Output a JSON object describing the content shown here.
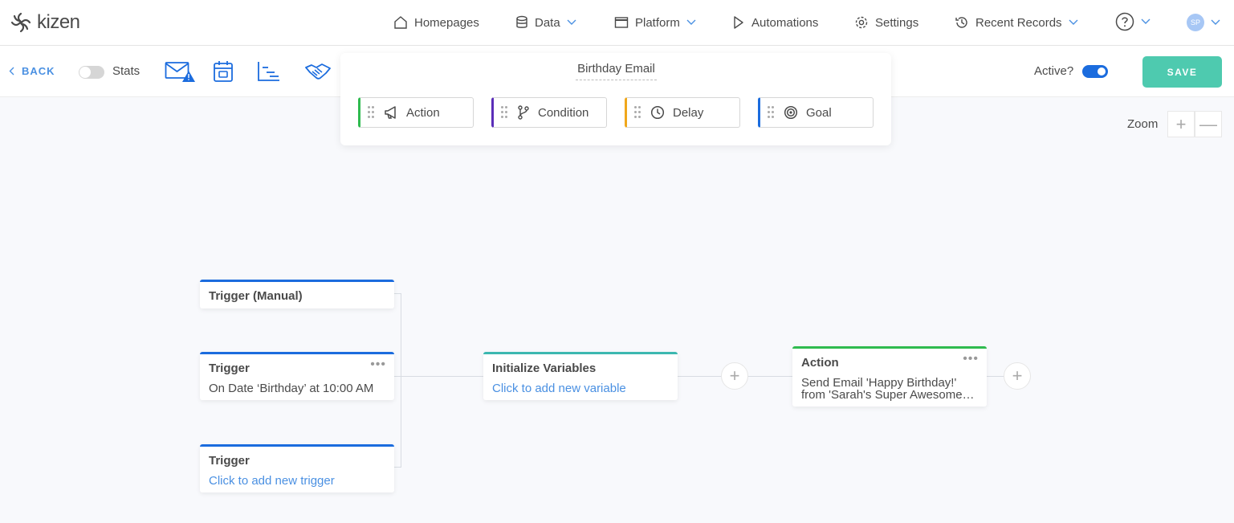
{
  "app": {
    "logo_text": "kizen"
  },
  "topnav": {
    "items": [
      {
        "label": "Homepages",
        "icon": "home-icon",
        "has_dropdown": false
      },
      {
        "label": "Data",
        "icon": "database-icon",
        "has_dropdown": true
      },
      {
        "label": "Platform",
        "icon": "window-icon",
        "has_dropdown": true
      },
      {
        "label": "Automations",
        "icon": "play-icon",
        "has_dropdown": false
      },
      {
        "label": "Settings",
        "icon": "gear-icon",
        "has_dropdown": false
      },
      {
        "label": "Recent Records",
        "icon": "history-icon",
        "has_dropdown": true
      }
    ],
    "help_icon": "question-icon",
    "avatar_initials": "SP"
  },
  "toolbar": {
    "back_label": "BACK",
    "stats_label": "Stats",
    "stats_enabled": false,
    "tool_icons": [
      "email-warning-icon",
      "calendar-icon",
      "timeline-icon",
      "handshake-icon"
    ],
    "active_label": "Active?",
    "active_enabled": true,
    "save_label": "SAVE"
  },
  "palette": {
    "flow_title": "Birthday Email",
    "steps": [
      {
        "label": "Action",
        "icon": "megaphone-icon",
        "color": "#2fbb4f"
      },
      {
        "label": "Condition",
        "icon": "branch-icon",
        "color": "#5b2eb8"
      },
      {
        "label": "Delay",
        "icon": "clock-icon",
        "color": "#f0a71b"
      },
      {
        "label": "Goal",
        "icon": "target-icon",
        "color": "#1b6cde"
      }
    ]
  },
  "zoom": {
    "label": "Zoom",
    "in_symbol": "+",
    "out_symbol": "—"
  },
  "canvas": {
    "trigger_manual": {
      "title": "Trigger (Manual)"
    },
    "trigger_date": {
      "title": "Trigger",
      "text": "On Date ‘Birthday’ at 10:00 AM"
    },
    "trigger_empty": {
      "title": "Trigger",
      "link": "Click to add new trigger"
    },
    "init_vars": {
      "title": "Initialize Variables",
      "link": "Click to add new variable",
      "color": "#3cb8b0"
    },
    "action": {
      "title": "Action",
      "line1": "Send Email 'Happy Birthday!'",
      "line2": "from 'Sarah's Super Awesome…",
      "color": "#2fbb4f"
    },
    "plus_symbol": "+",
    "more_symbol": "•••"
  },
  "colors": {
    "accent": "#4a90e2",
    "primary": "#1b6cde",
    "save": "#4ecaaf"
  }
}
